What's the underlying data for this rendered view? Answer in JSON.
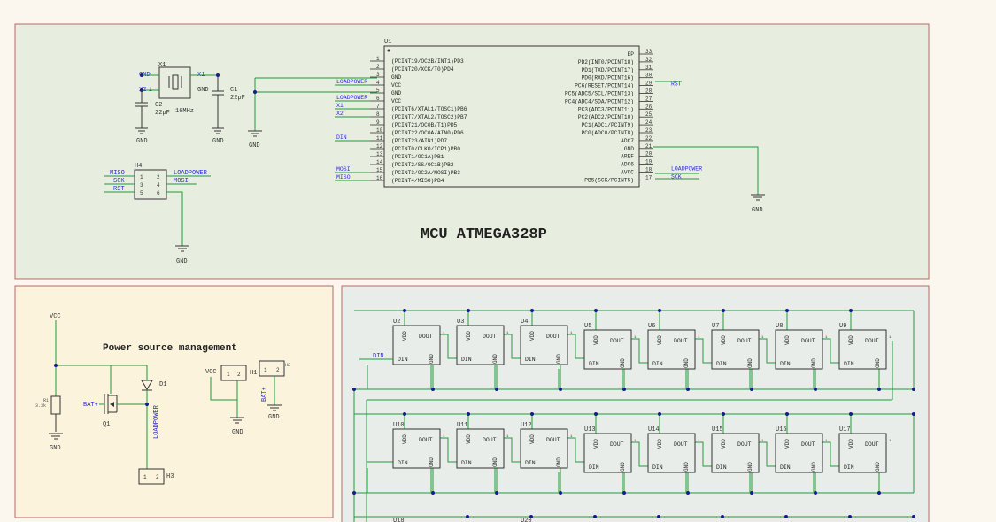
{
  "colors": {
    "background": "#fbf7ef",
    "mcu_panel": "#e8eedf",
    "power_panel": "#fbf3dc",
    "led_panel": "#e9edea",
    "panel_border": "#b56a6a",
    "wire": "#1f9a3a",
    "component": "#333333",
    "label_blue": "#2b2bd6",
    "junction": "#1a1a8a"
  },
  "mcu": {
    "title": "MCU ATMEGA328P",
    "chip_ref": "U1",
    "left_pins": [
      {
        "num": "1",
        "name": "(PCINT19/OC2B/INT1)PD3",
        "net": ""
      },
      {
        "num": "2",
        "name": "(PCINT20/XCK/T0)PD4",
        "net": ""
      },
      {
        "num": "3",
        "name": "GND",
        "net": ""
      },
      {
        "num": "4",
        "name": "VCC",
        "net": "LOADPOWER"
      },
      {
        "num": "5",
        "name": "GND",
        "net": ""
      },
      {
        "num": "6",
        "name": "VCC",
        "net": "LOADPOWER"
      },
      {
        "num": "7",
        "name": "(PCINT6/XTAL1/TOSC1)PB6",
        "net": "X1"
      },
      {
        "num": "8",
        "name": "(PCINT7/XTAL2/TOSC2)PB7",
        "net": "X2"
      },
      {
        "num": "9",
        "name": "(PCINT21/OC0B/T1)PD5",
        "net": ""
      },
      {
        "num": "10",
        "name": "(PCINT22/OC0A/AIN0)PD6",
        "net": ""
      },
      {
        "num": "11",
        "name": "(PCINT23/AIN1)PD7",
        "net": "DIN"
      },
      {
        "num": "12",
        "name": "(PCINT0/CLKO/ICP1)PB0",
        "net": ""
      },
      {
        "num": "13",
        "name": "(PCINT1/OC1A)PB1",
        "net": ""
      },
      {
        "num": "14",
        "name": "(PCINT2/SS/OC1B)PB2",
        "net": ""
      },
      {
        "num": "15",
        "name": "(PCINT3/OC2A/MOSI)PB3",
        "net": "MOSI"
      },
      {
        "num": "16",
        "name": "(PCINT4/MISO)PB4",
        "net": "MISO"
      }
    ],
    "right_pins": [
      {
        "num": "33",
        "name": "EP",
        "net": ""
      },
      {
        "num": "32",
        "name": "PD2(INT0/PCINT18)",
        "net": ""
      },
      {
        "num": "31",
        "name": "PD1(TXD/PCINT17)",
        "net": ""
      },
      {
        "num": "30",
        "name": "PD0(RXD/PCINT16)",
        "net": ""
      },
      {
        "num": "29",
        "name": "PC6(RESET/PCINT14)",
        "net": "RST"
      },
      {
        "num": "28",
        "name": "PC5(ADC5/SCL/PCINT13)",
        "net": ""
      },
      {
        "num": "27",
        "name": "PC4(ADC4/SDA/PCINT12)",
        "net": ""
      },
      {
        "num": "26",
        "name": "PC3(ADC3/PCINT11)",
        "net": ""
      },
      {
        "num": "25",
        "name": "PC2(ADC2/PCINT10)",
        "net": ""
      },
      {
        "num": "24",
        "name": "PC1(ADC1/PCINT9)",
        "net": ""
      },
      {
        "num": "23",
        "name": "PC0(ADC0/PCINT8)",
        "net": ""
      },
      {
        "num": "22",
        "name": "ADC7",
        "net": ""
      },
      {
        "num": "21",
        "name": "GND",
        "net": ""
      },
      {
        "num": "20",
        "name": "AREF",
        "net": ""
      },
      {
        "num": "19",
        "name": "ADC6",
        "net": ""
      },
      {
        "num": "18",
        "name": "AVCC",
        "net": "LOADPOWER"
      },
      {
        "num": "17",
        "name": "PB5(SCK/PCINT5)",
        "net": "SCK"
      }
    ],
    "gnd_label": "GND",
    "crystal": {
      "ref": "X1",
      "freq": "16MHz",
      "pin_gnd": "GND",
      "pin_x1": "X1",
      "pin_x2": "X2",
      "pin4": "4",
      "pin1": "1",
      "gnd_right": "GND"
    },
    "c1": {
      "ref": "C1",
      "value": "22pF"
    },
    "c2": {
      "ref": "C2",
      "value": "22pF"
    },
    "header": {
      "ref": "H4",
      "left_nets": [
        "MISO",
        "SCK",
        "RST"
      ],
      "right_nets": [
        "LOADPOWER",
        "MOSI"
      ],
      "left_nums": [
        "1",
        "3",
        "5"
      ],
      "right_nums": [
        "2",
        "4",
        "6"
      ]
    }
  },
  "power": {
    "title": "Power source management",
    "vcc": "VCC",
    "gnd": "GND",
    "r1_ref": "R1",
    "r1_value": "3.3k",
    "bat_label": "BAT+",
    "q1": "Q1",
    "d1": "D1",
    "loadpower": "LOADPOWER",
    "h3": "H3",
    "h1": "H1",
    "h2": "H2",
    "h_pins": [
      "1",
      "2"
    ]
  },
  "leds": {
    "refs": [
      "U2",
      "U3",
      "U4",
      "U5",
      "U6",
      "U7",
      "U8",
      "U9",
      "U10",
      "U11",
      "U12",
      "U13",
      "U14",
      "U15",
      "U16",
      "U17"
    ],
    "partial_refs": [
      "U18",
      "U20"
    ],
    "vdd": "VDD",
    "gnd": "GND",
    "din": "DIN",
    "dout": "DOUT",
    "din_net": "DIN",
    "pin_nums": [
      "1",
      "2",
      "3",
      "4"
    ]
  }
}
